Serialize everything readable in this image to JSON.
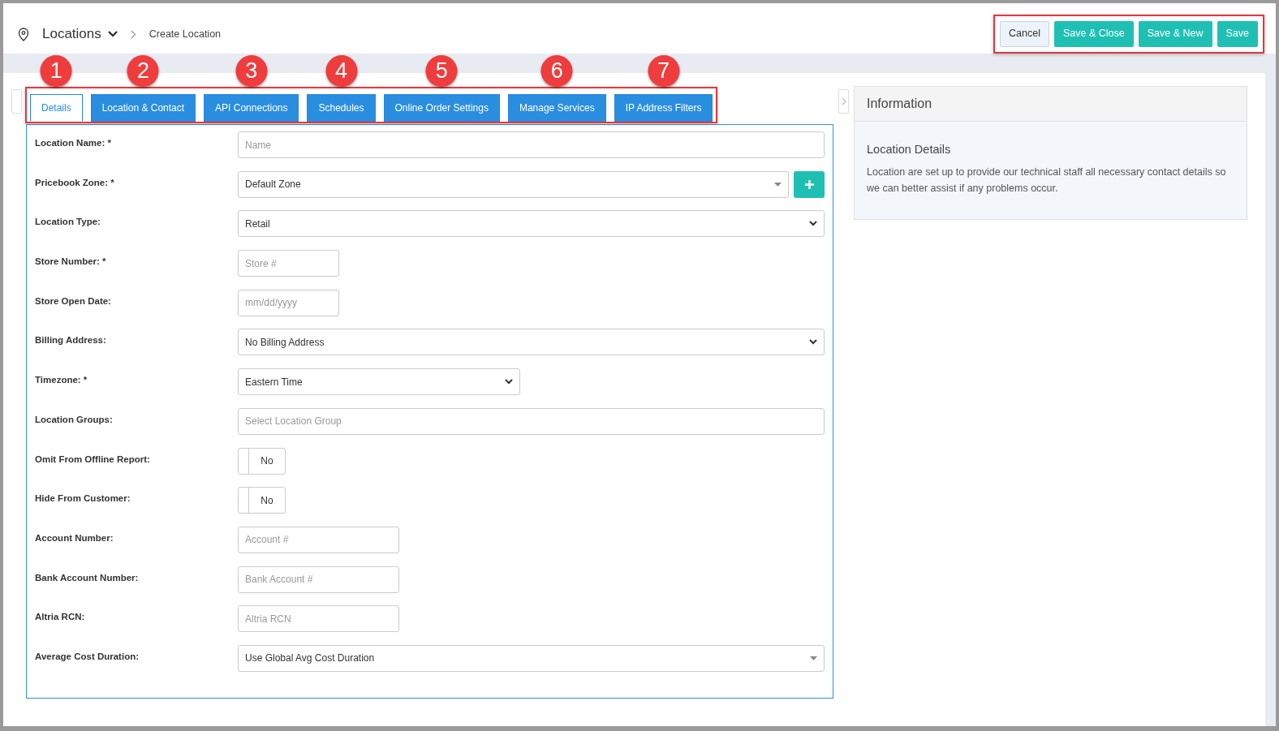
{
  "header": {
    "title": "Locations",
    "breadcrumb": "Create Location",
    "buttons": [
      {
        "label": "Cancel",
        "kind": "secondary"
      },
      {
        "label": "Save & Close",
        "kind": "primary"
      },
      {
        "label": "Save & New",
        "kind": "primary"
      },
      {
        "label": "Save",
        "kind": "primary"
      }
    ]
  },
  "tabs": [
    {
      "label": "Details",
      "selected": true,
      "callout": "1"
    },
    {
      "label": "Location & Contact",
      "selected": false,
      "callout": "2"
    },
    {
      "label": "API Connections",
      "selected": false,
      "callout": "3"
    },
    {
      "label": "Schedules",
      "selected": false,
      "callout": "4"
    },
    {
      "label": "Online Order Settings",
      "selected": false,
      "callout": "5"
    },
    {
      "label": "Manage Services",
      "selected": false,
      "callout": "6"
    },
    {
      "label": "IP Address Filters",
      "selected": false,
      "callout": "7"
    }
  ],
  "form": [
    {
      "label": "Location Name: *",
      "kind": "text",
      "placeholder": "Name"
    },
    {
      "label": "Pricebook Zone: *",
      "kind": "combo-add",
      "value": "Default Zone"
    },
    {
      "label": "Location Type:",
      "kind": "select",
      "value": "Retail"
    },
    {
      "label": "Store Number: *",
      "kind": "short-text",
      "placeholder": "Store #"
    },
    {
      "label": "Store Open Date:",
      "kind": "short-text",
      "placeholder": "mm/dd/yyyy"
    },
    {
      "label": "Billing Address:",
      "kind": "select",
      "value": "No Billing Address"
    },
    {
      "label": "Timezone: *",
      "kind": "half-select",
      "value": "Eastern Time"
    },
    {
      "label": "Location Groups:",
      "kind": "text",
      "placeholder": "Select Location Group"
    },
    {
      "label": "Omit From Offline Report:",
      "kind": "toggle",
      "on": false,
      "value": "No"
    },
    {
      "label": "Hide From Customer:",
      "kind": "toggle",
      "on": false,
      "value": "No"
    },
    {
      "label": "Account Number:",
      "kind": "medium-text",
      "placeholder": "Account #"
    },
    {
      "label": "Bank Account Number:",
      "kind": "medium-text",
      "placeholder": "Bank Account #"
    },
    {
      "label": "Altria RCN:",
      "kind": "medium-text",
      "placeholder": "Altria RCN"
    },
    {
      "label": "Average Cost Duration:",
      "kind": "combo",
      "value": "Use Global Avg Cost Duration"
    }
  ],
  "info": {
    "title": "Information",
    "heading": "Location Details",
    "text": "Location are set up to provide our technical staff all necessary contact details so we can better assist if any problems occur."
  }
}
